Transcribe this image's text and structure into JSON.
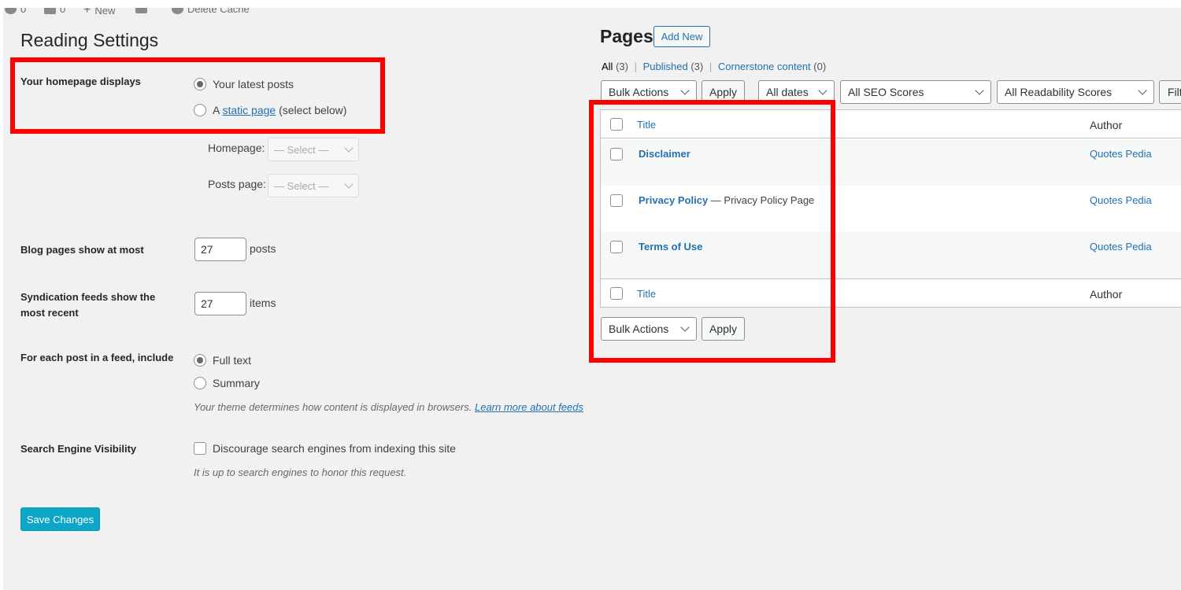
{
  "admin_bar": {
    "updates_count": "0",
    "comments_count": "0",
    "new_label": "New",
    "cache_label": "Delete Cache"
  },
  "reading": {
    "title": "Reading Settings",
    "homepage_displays": {
      "label": "Your homepage displays",
      "option_latest": "Your latest posts",
      "option_static_prefix": "A",
      "option_static_link": "static page",
      "option_static_suffix": "(select below)",
      "selected": "latest"
    },
    "homepage_select": {
      "label": "Homepage:",
      "value": "— Select —"
    },
    "posts_page_select": {
      "label": "Posts page:",
      "value": "— Select —"
    },
    "blog_pages": {
      "label": "Blog pages show at most",
      "value": "27",
      "unit": "posts"
    },
    "syndication": {
      "label_line1": "Syndication feeds show the",
      "label_line2": "most recent",
      "value": "27",
      "unit": "items"
    },
    "feed_content": {
      "label": "For each post in a feed, include",
      "option_full": "Full text",
      "option_summary": "Summary",
      "selected": "full",
      "desc_text": "Your theme determines how content is displayed in browsers.",
      "desc_link": "Learn more about feeds"
    },
    "search_visibility": {
      "label": "Search Engine Visibility",
      "checkbox_label": "Discourage search engines from indexing this site",
      "checked": false,
      "desc": "It is up to search engines to honor this request."
    },
    "save_label": "Save Changes"
  },
  "pages": {
    "title": "Pages",
    "add_new": "Add New",
    "filters": {
      "all_label": "All",
      "all_count": "(3)",
      "published_label": "Published",
      "published_count": "(3)",
      "cornerstone_label": "Cornerstone content",
      "cornerstone_count": "(0)",
      "separator": "|"
    },
    "bulk_actions": "Bulk Actions",
    "apply": "Apply",
    "dates": "All dates",
    "seo": "All SEO Scores",
    "readability": "All Readability Scores",
    "filter_btn": "Filter",
    "columns": {
      "title": "Title",
      "author": "Author"
    },
    "rows": [
      {
        "title": "Disclaimer",
        "state": "",
        "author": "Quotes Pedia"
      },
      {
        "title": "Privacy Policy",
        "state": "— Privacy Policy Page",
        "author": "Quotes Pedia"
      },
      {
        "title": "Terms of Use",
        "state": "",
        "author": "Quotes Pedia"
      }
    ]
  },
  "colors": {
    "annotation": "#ff0000",
    "primary_button": "#0da5c8",
    "link": "#2271b1"
  }
}
